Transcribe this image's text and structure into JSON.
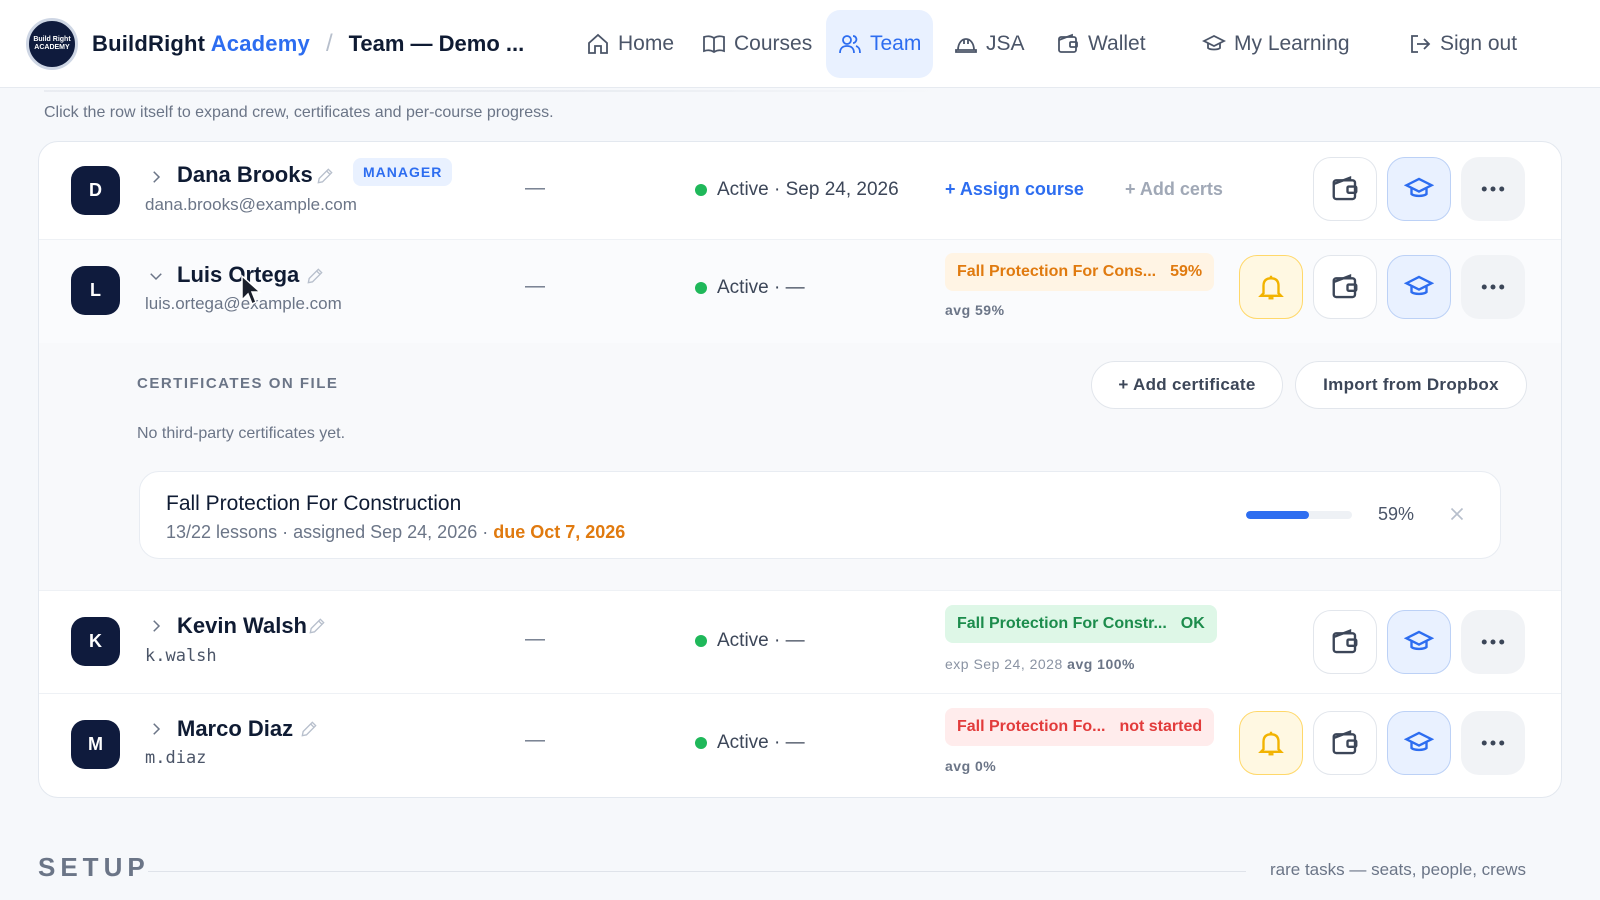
{
  "header": {
    "brand_part1": "BuildRight",
    "brand_part2": "Academy",
    "logo_text": "Build Right ACADEMY",
    "breadcrumb": "Team — Demo ...",
    "nav": [
      {
        "label": "Home",
        "icon": "home-icon",
        "active": false
      },
      {
        "label": "Courses",
        "icon": "book-icon",
        "active": false
      },
      {
        "label": "Team",
        "icon": "users-icon",
        "active": true
      },
      {
        "label": "JSA",
        "icon": "hard-hat-icon",
        "active": false
      },
      {
        "label": "Wallet",
        "icon": "wallet-icon",
        "active": false
      },
      {
        "label": "My Learning",
        "icon": "graduation-cap-icon",
        "active": false
      },
      {
        "label": "Sign out",
        "icon": "sign-out-icon",
        "active": false
      }
    ]
  },
  "hint": "Click the row itself to expand crew, certificates and per-course progress.",
  "members": [
    {
      "initial": "D",
      "name": "Dana Brooks",
      "email": "dana.brooks@example.com",
      "badge": "MANAGER",
      "crew": "—",
      "status": "Active · Sep 24, 2026",
      "assign_label": "+ Assign course",
      "certs_label": "+ Add certs"
    },
    {
      "initial": "L",
      "name": "Luis Ortega",
      "email": "luis.ortega@example.com",
      "crew": "—",
      "status": "Active · —",
      "chip_course": "Fall Protection For Cons...",
      "chip_value": "59%",
      "note_avg": "avg 59%",
      "expanded": true
    },
    {
      "initial": "K",
      "name": "Kevin Walsh",
      "email": "k.walsh",
      "crew": "—",
      "status": "Active · —",
      "chip_course": "Fall Protection For Constr...",
      "chip_value": "OK",
      "note_exp": "exp Sep 24, 2028",
      "note_avg": "avg 100%"
    },
    {
      "initial": "M",
      "name": "Marco Diaz",
      "email": "m.diaz",
      "crew": "—",
      "status": "Active · —",
      "chip_course": "Fall Protection Fo...",
      "chip_value": "not started",
      "note_avg": "avg 0%"
    }
  ],
  "expanded_panel": {
    "certificates_title": "CERTIFICATES ON FILE",
    "add_certificate_label": "+ Add certificate",
    "import_label": "Import from Dropbox",
    "empty_text": "No third-party certificates yet.",
    "course": {
      "name": "Fall Protection For Construction",
      "meta": "13/22 lessons · assigned Sep 24, 2026 · ",
      "due": "due Oct 7, 2026",
      "progress": 0.59,
      "progress_label": "59%"
    }
  },
  "setup": {
    "title": "SETUP",
    "note": "rare tasks — seats, people, crews"
  },
  "colors": {
    "accent": "#2d6df0",
    "navy": "#0f1b3d",
    "active_dot": "#1fb85a",
    "warning": "#e07a0f",
    "danger": "#e23b3b",
    "success": "#1c8c4c"
  }
}
